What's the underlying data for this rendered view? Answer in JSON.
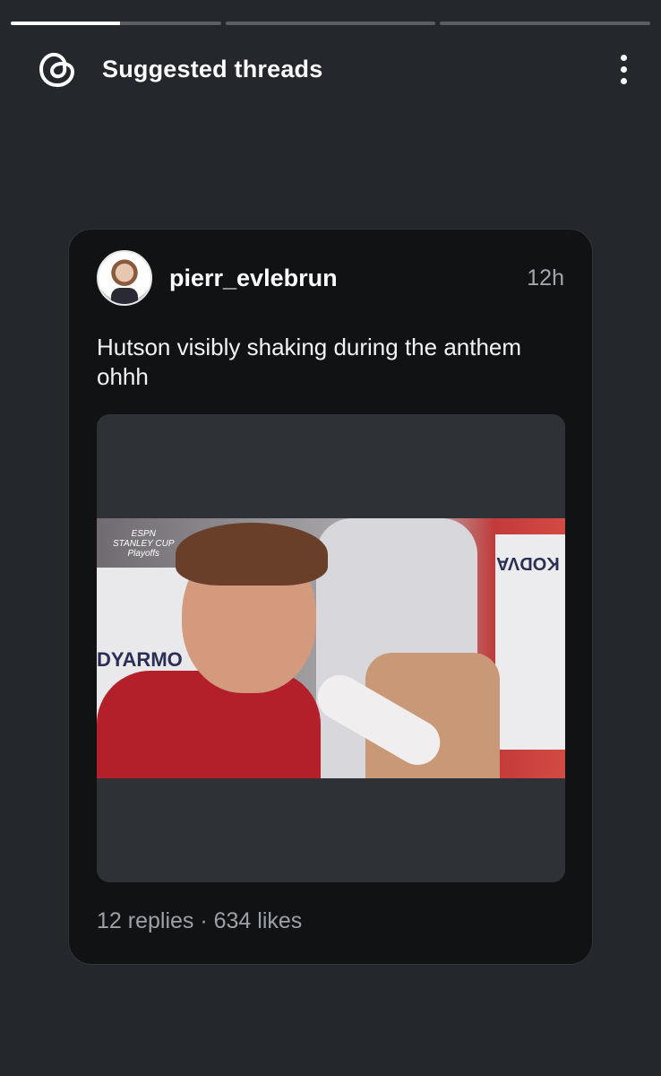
{
  "progress": {
    "segments": [
      {
        "fill": 0.52
      },
      {
        "fill": 0
      },
      {
        "fill": 0
      }
    ]
  },
  "header": {
    "title": "Suggested threads",
    "logo_icon": "threads-logo-icon",
    "menu_icon": "more-vertical-icon"
  },
  "post": {
    "username": "pierr_evlebrun",
    "time": "12h",
    "text": "Hutson visibly shaking during the anthem ohhh",
    "media": {
      "overlay_logo_lines": [
        "ESPN",
        "STANLEY CUP",
        "Playoffs"
      ],
      "banner_left": "DYARMO",
      "banner_right": "KODVA"
    },
    "stats": "12 replies · 634 likes"
  },
  "colors": {
    "background": "#24272b",
    "card": "#101214",
    "muted_text": "#9da1a7"
  }
}
